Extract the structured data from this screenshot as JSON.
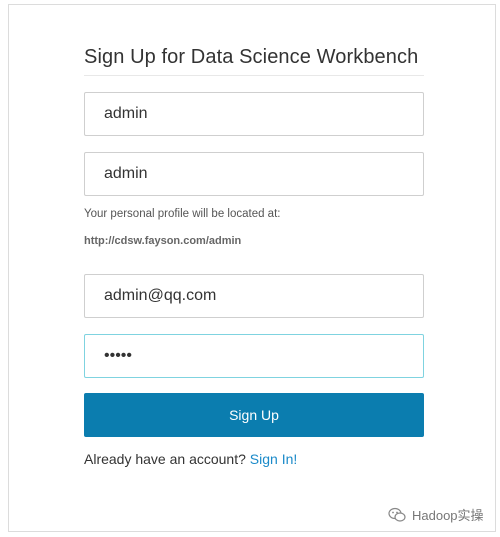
{
  "form": {
    "title": "Sign Up for Data Science Workbench",
    "username_value": "admin",
    "fullname_value": "admin",
    "profile_hint": "Your personal profile will be located at:",
    "profile_url": "http://cdsw.fayson.com/admin",
    "email_value": "admin@qq.com",
    "password_value": "admin",
    "signup_label": "Sign Up",
    "signin_prompt": "Already have an account?",
    "signin_link": "Sign In!"
  },
  "colors": {
    "button": "#0b7daf",
    "link": "#1b8ac9",
    "focus_border": "#7fd3e0"
  },
  "watermark": {
    "icon": "wechat-icon",
    "text": "Hadoop实操"
  }
}
